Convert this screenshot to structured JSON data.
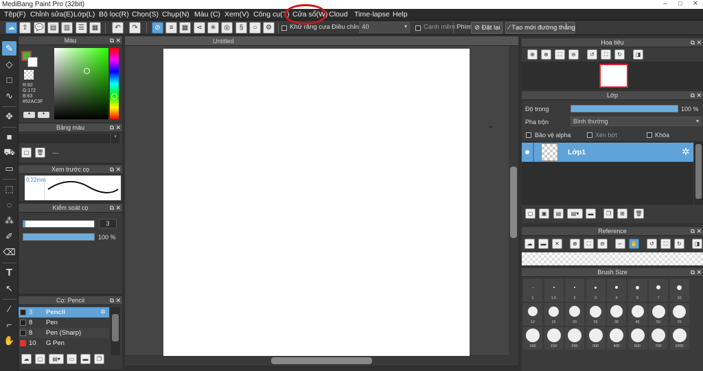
{
  "window": {
    "title": "MediBang Paint Pro (32bit)"
  },
  "menu": [
    "Tệp(F)",
    "Chỉnh sửa(E)",
    "Lớp(L)",
    "Bộ lọc(R)",
    "Chọn(S)",
    "Chụp(N)",
    "Màu (C)",
    "Xem(V)",
    "Công cụ(T)",
    "Cửa sổ(W)",
    "Cloud",
    "Time-lapse",
    "Help"
  ],
  "toolbar": {
    "antialias_label": "Khử răng cưa",
    "correction_label": "Điều chỉnh",
    "correction_value": "40",
    "smooth_label": "Cạnh mềm",
    "key_label": "Phím",
    "reset_label": "Đặt lại",
    "line_label": "Tạo mới đường thẳng"
  },
  "colors": {
    "accent": "#5fa3d8",
    "highlight_circle": "#c91a1a",
    "foreground": "#52AC3F"
  },
  "color_panel": {
    "title": "Màu",
    "r": "R:82",
    "g": "G:172",
    "b": "B:63",
    "hex": "#52AC3F"
  },
  "palette_panel": {
    "title": "Bảng màu",
    "value": "---"
  },
  "brush_preview": {
    "title": "Xem trước cọ",
    "size": "0.22mm"
  },
  "brush_control": {
    "title": "Kiểm soát cọ",
    "size": "3",
    "opacity": "100 %",
    "opacity_fraction": 1.0
  },
  "brush_panel": {
    "title": "Cọ: Pencil",
    "items": [
      {
        "size": "3",
        "name": "Pencil",
        "color": "#222222",
        "selected": true
      },
      {
        "size": "8",
        "name": "Pen",
        "color": "#222222",
        "selected": false
      },
      {
        "size": "8",
        "name": "Pen (Sharp)",
        "color": "#222222",
        "selected": false
      },
      {
        "size": "10",
        "name": "G Pen",
        "color": "#e53030",
        "selected": false
      }
    ]
  },
  "canvas": {
    "tab_title": "Untitled"
  },
  "navigator": {
    "title": "Hoa tiêu"
  },
  "layer_panel": {
    "title": "Lớp",
    "opacity_label": "Độ trong",
    "opacity_value": "100 %",
    "opacity_fraction": 1.0,
    "blend_label": "Pha trộn",
    "blend_value": "Bình thường",
    "protect_alpha": "Bảo vệ alpha",
    "clipping": "Xén bớt",
    "lock": "Khóa",
    "layer_name": "Lớp1"
  },
  "reference": {
    "title": "Reference"
  },
  "brush_size": {
    "title": "Brush Size",
    "sizes": [
      "1",
      "1.5",
      "2",
      "3",
      "4",
      "5",
      "7",
      "10",
      "12",
      "15",
      "20",
      "25",
      "30",
      "40",
      "50",
      "70",
      "100",
      "150",
      "200",
      "300",
      "400",
      "500",
      "700",
      "1000"
    ]
  }
}
